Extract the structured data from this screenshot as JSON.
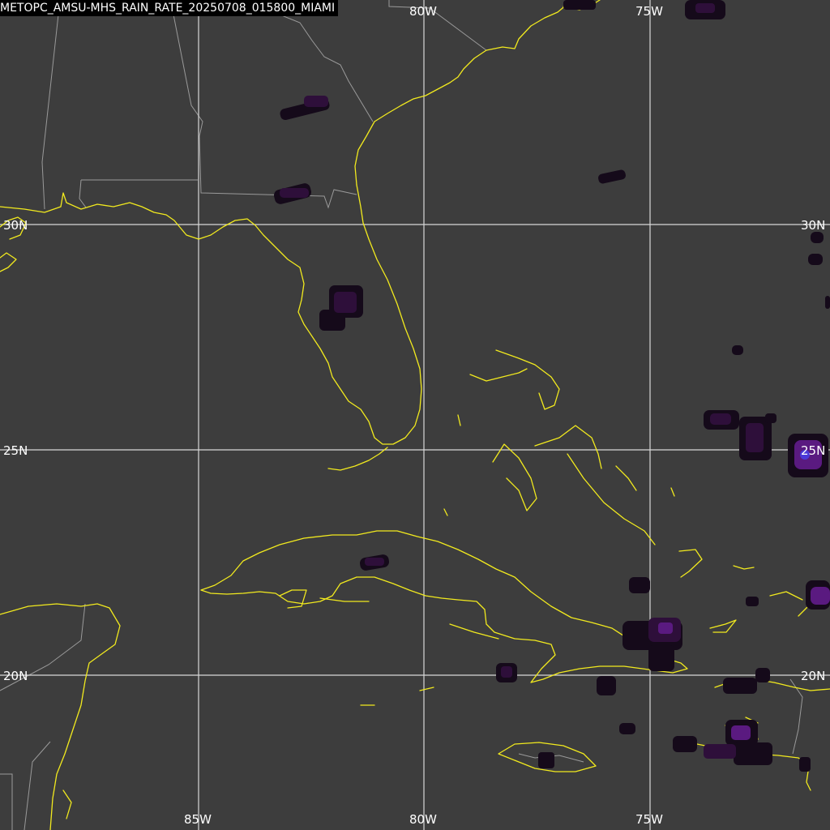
{
  "product_title": "METOPC_AMSU-MHS_RAIN_RATE_20250708_015800_MIAMI",
  "grid": {
    "lon_top": [
      "80W",
      "75W"
    ],
    "lon_bottom": [
      "85W",
      "80W",
      "75W"
    ],
    "lat_left": [
      "30N",
      "25N",
      "20N"
    ],
    "lat_right": [
      "30N",
      "25N",
      "20N"
    ]
  },
  "colors": {
    "background": "#3d3d3d",
    "coastline": "#f2ea1e",
    "political_border": "#9a9a9a",
    "graticule": "#d8d8d8",
    "rain_low": "#150a1a",
    "rain_mid": "#2e0f3a",
    "rain_high": "#5a1a80",
    "rain_peak": "#4a38d8"
  }
}
